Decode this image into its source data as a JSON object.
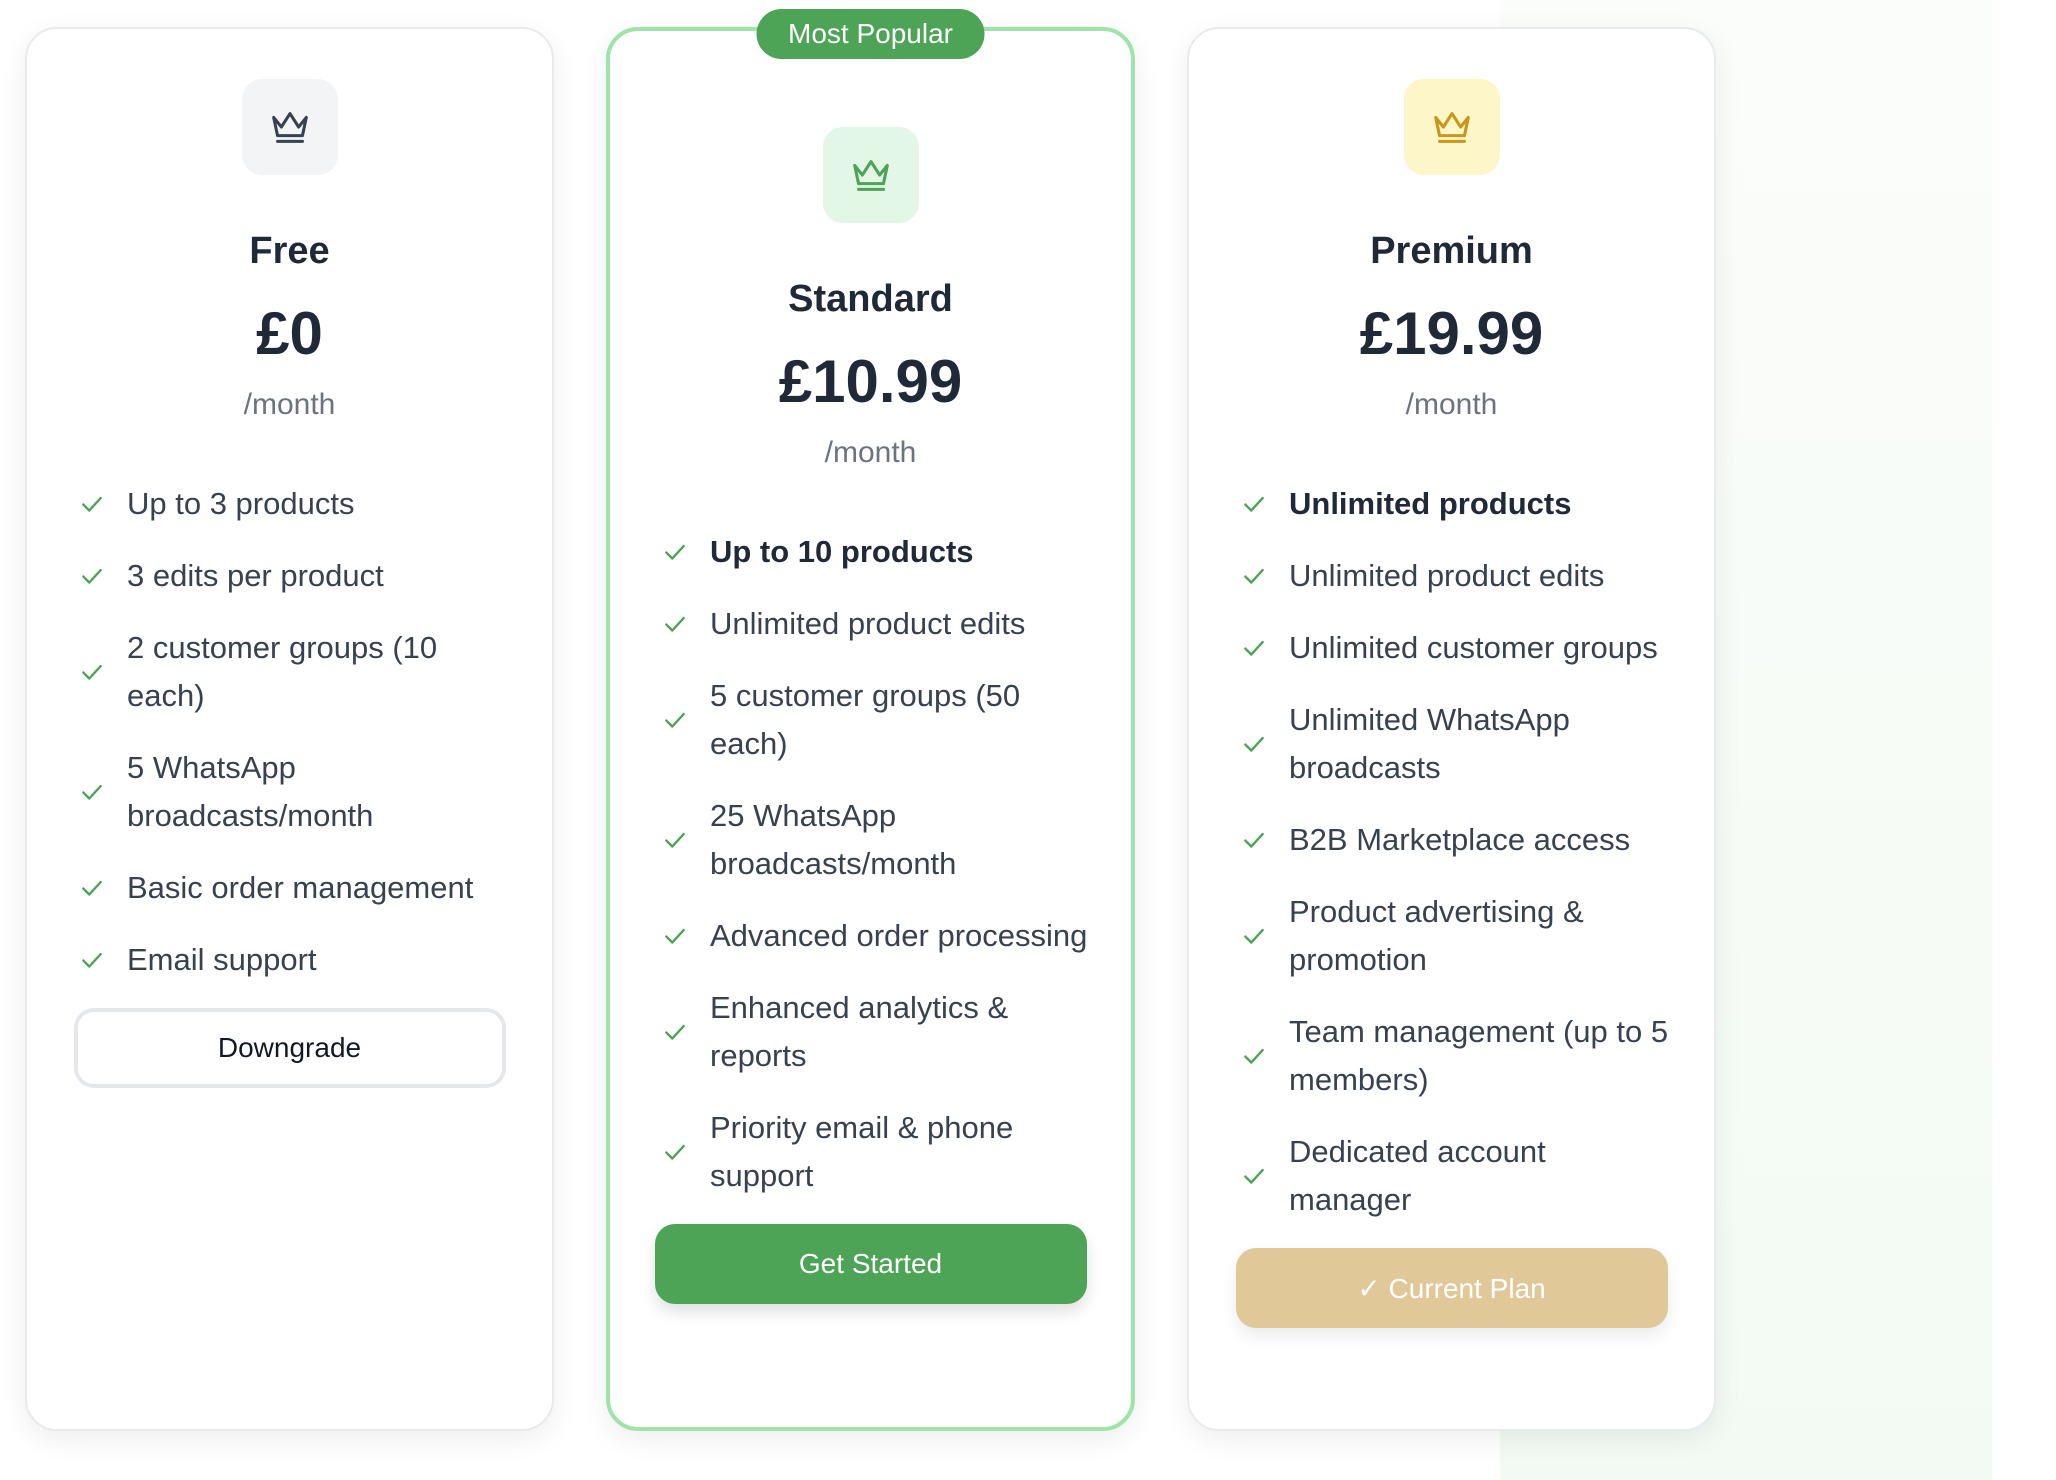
{
  "colors": {
    "accent_green": "#4da356",
    "popular_border": "#9ee3a8",
    "gold_button": "#e1c898",
    "gold_icon": "#c9961a",
    "gray_icon": "#374151"
  },
  "plans": [
    {
      "name": "Free",
      "price": "£0",
      "period": "/month",
      "icon": "crown-icon",
      "features": [
        "Up to 3 products",
        "3 edits per product",
        "2 customer groups (10 each)",
        "5 WhatsApp broadcasts/month",
        "Basic order management",
        "Email support"
      ],
      "button_label": "Downgrade"
    },
    {
      "name": "Standard",
      "badge": "Most Popular",
      "price": "£10.99",
      "period": "/month",
      "icon": "crown-icon",
      "features": [
        "Up to 10 products",
        "Unlimited product edits",
        "5 customer groups (50 each)",
        "25 WhatsApp broadcasts/month",
        "Advanced order processing",
        "Enhanced analytics & reports",
        "Priority email & phone support"
      ],
      "button_label": "Get Started"
    },
    {
      "name": "Premium",
      "price": "£19.99",
      "period": "/month",
      "icon": "crown-icon",
      "features": [
        "Unlimited products",
        "Unlimited product edits",
        "Unlimited customer groups",
        "Unlimited WhatsApp broadcasts",
        "B2B Marketplace access",
        "Product advertising & promotion",
        "Team management (up to 5 members)",
        "Dedicated account manager"
      ],
      "button_label": "✓ Current Plan"
    }
  ]
}
